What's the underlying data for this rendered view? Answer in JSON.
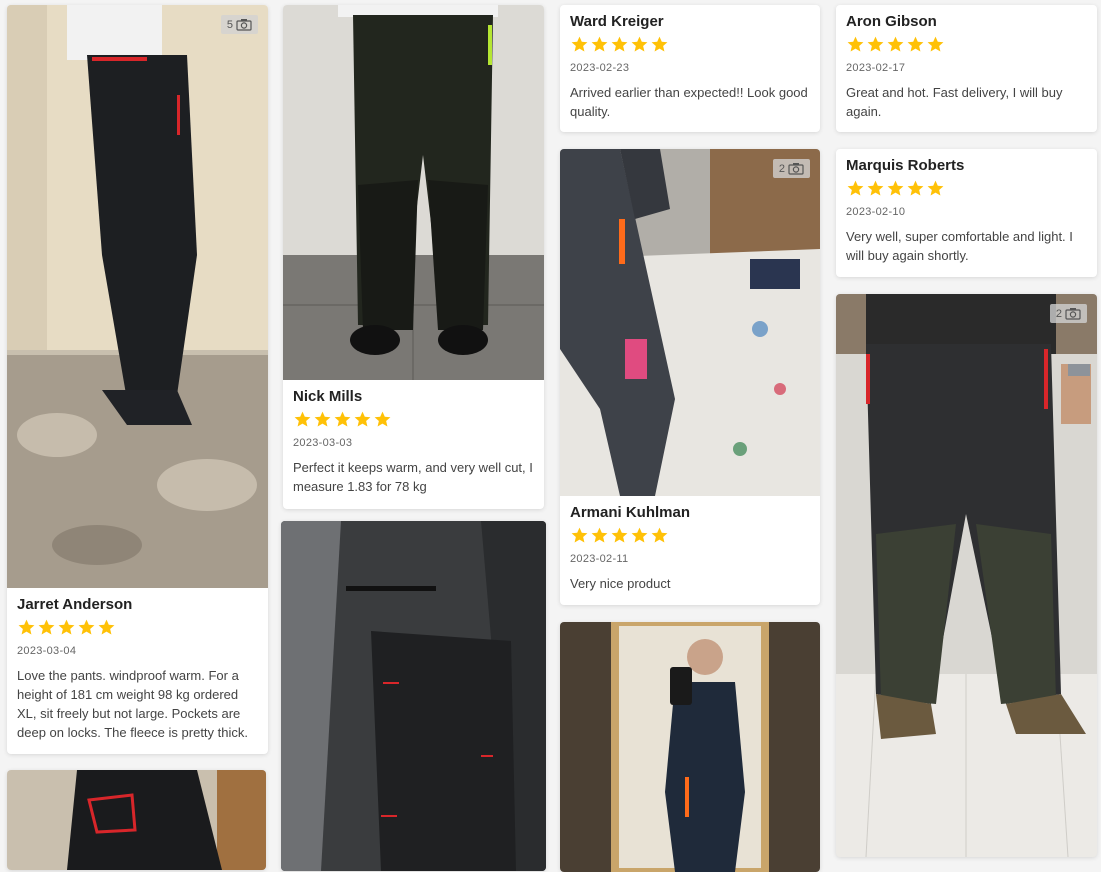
{
  "colors": {
    "star": "#ffc107",
    "accent_red": "#d8262a",
    "accent_orange": "#ff6b1a"
  },
  "reviews": [
    {
      "name": "Jarret Anderson",
      "date": "2023-03-04",
      "photo_count": "5",
      "rating": 5,
      "text": "Love the pants. windproof warm. For a height of 181 cm weight 98 kg ordered XL, sit freely but not large. Pockets are deep on locks. The fleece is pretty thick."
    },
    {
      "name": "Nick Mills",
      "date": "2023-03-03",
      "rating": 5,
      "text": "Perfect it keeps warm, and very well cut, I measure 1.83 for 78 kg"
    },
    {
      "name": "Ward Kreiger",
      "date": "2023-02-23",
      "rating": 5,
      "text": "Arrived earlier than expected!! Look good quality."
    },
    {
      "name": "Armani Kuhlman",
      "date": "2023-02-11",
      "photo_count": "2",
      "rating": 5,
      "text": "Very nice product"
    },
    {
      "name": "Aron Gibson",
      "date": "2023-02-17",
      "rating": 5,
      "text": "Great and hot. Fast delivery, I will buy again."
    },
    {
      "name": "Marquis Roberts",
      "date": "2023-02-10",
      "rating": 5,
      "text": "Very well, super comfortable and light. I will buy again shortly."
    },
    {
      "photo_count": "2"
    }
  ]
}
